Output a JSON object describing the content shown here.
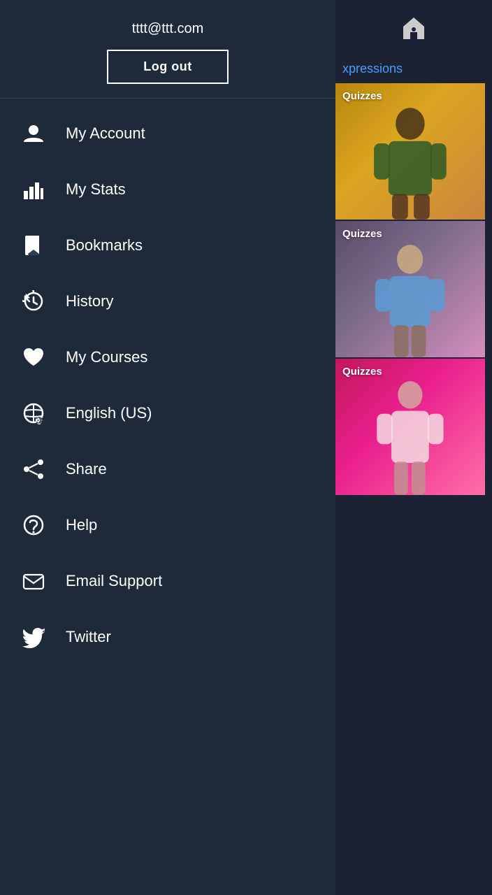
{
  "user": {
    "email": "tttt@ttt.com",
    "logout_label": "Log out"
  },
  "menu": {
    "items": [
      {
        "id": "my-account",
        "label": "My Account",
        "icon": "account"
      },
      {
        "id": "my-stats",
        "label": "My Stats",
        "icon": "stats"
      },
      {
        "id": "bookmarks",
        "label": "Bookmarks",
        "icon": "bookmark"
      },
      {
        "id": "history",
        "label": "History",
        "icon": "history"
      },
      {
        "id": "my-courses",
        "label": "My Courses",
        "icon": "heart"
      },
      {
        "id": "english-us",
        "label": "English (US)",
        "icon": "language"
      },
      {
        "id": "share",
        "label": "Share",
        "icon": "share"
      },
      {
        "id": "help",
        "label": "Help",
        "icon": "help"
      },
      {
        "id": "email-support",
        "label": "Email Support",
        "icon": "email"
      },
      {
        "id": "twitter",
        "label": "Twitter",
        "icon": "twitter"
      }
    ]
  },
  "right_panel": {
    "expressions_label": "xpressions",
    "cards": [
      {
        "label": "Quizzes",
        "bg": "card-bg-1"
      },
      {
        "label": "Quizzes",
        "bg": "card-bg-2"
      },
      {
        "label": "Quizzes",
        "bg": "card-bg-3"
      }
    ]
  },
  "home_icon": "🏠"
}
